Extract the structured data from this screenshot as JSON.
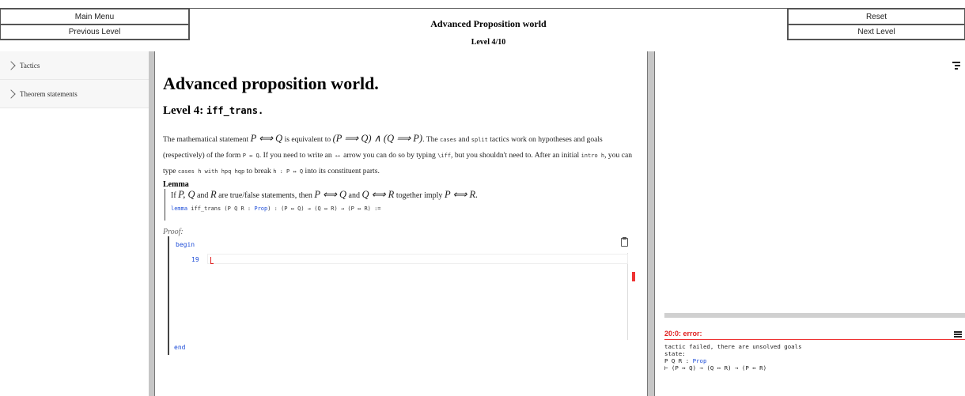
{
  "header": {
    "main_menu": "Main Menu",
    "previous_level": "Previous Level",
    "reset": "Reset",
    "next_level": "Next Level",
    "world_title": "Advanced Proposition world",
    "level_indicator": "Level 4/10"
  },
  "sidebar": {
    "items": [
      {
        "label": "Tactics"
      },
      {
        "label": "Theorem statements"
      }
    ]
  },
  "content": {
    "page_heading": "Advanced proposition world.",
    "level_prefix": "Level 4: ",
    "level_name": "iff_trans.",
    "desc": {
      "t1": "The mathematical statement ",
      "m1": "P ⟺ Q",
      "t2": " is equivalent to ",
      "m2": "(P ⟹ Q) ∧ (Q ⟹ P)",
      "t3": ". The ",
      "c1": "cases",
      "t4": " and ",
      "c2": "split",
      "t5": " tactics work on hypotheses and goals (respectively) of the form ",
      "c3": "P ↔ Q",
      "t6": ". If you need to write an ↔ arrow you can do so by typing ",
      "c4": "\\iff",
      "t7": ", but you shouldn't need to. After an initial ",
      "c5": "intro h",
      "t8": ", you can type ",
      "c6": "cases h with hpq hqp",
      "t9": " to break ",
      "c7": "h : P ↔ Q",
      "t10": " into its constituent parts."
    },
    "lemma_title": "Lemma",
    "lemma_statement": {
      "t1": "If ",
      "m1": "P, Q",
      "t2": " and ",
      "m2": "R",
      "t3": " are true/false statements, then ",
      "m3": "P ⟺ Q",
      "t4": " and ",
      "m4": "Q ⟺ R",
      "t5": " together imply ",
      "m5": "P ⟺ R."
    },
    "lemma_code": {
      "keyword": "lemma",
      "name": " iff_trans (P Q R : ",
      "type": "Prop",
      "rest": ") : (P ↔ Q) → (Q ↔ R) → (P ↔ R) :="
    },
    "proof_label": "Proof:",
    "begin_kw": "begin",
    "line_number": "19",
    "end_kw": "end"
  },
  "infoview": {
    "error_title": "20:0: error:",
    "error_line1": "tactic failed, there are unsolved goals",
    "error_line2": "state:",
    "error_line3_a": "P Q R : ",
    "error_line3_type": "Prop",
    "error_line4": "⊢ (P ↔ Q) → (Q ↔ R) → (P ↔ R)"
  },
  "colors": {
    "keyword": "#1f4ed8",
    "error": "#e02020",
    "splitter": "#c6c6c6"
  }
}
